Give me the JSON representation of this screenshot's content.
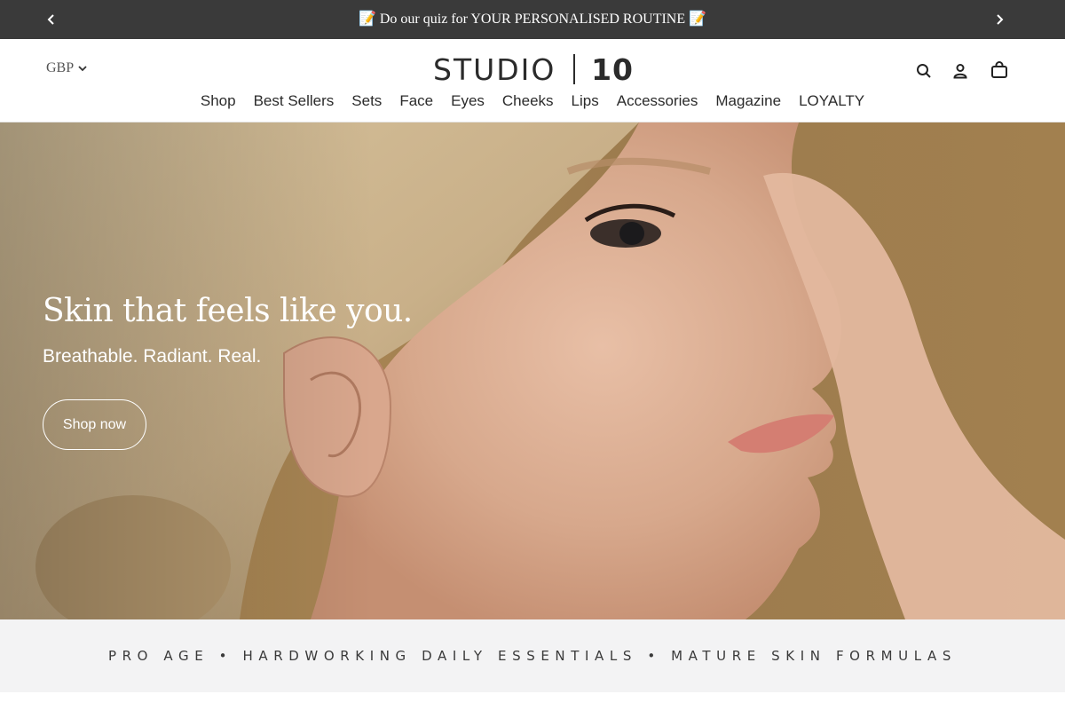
{
  "announcement": {
    "message": "📝 Do our quiz for YOUR PERSONALISED ROUTINE 📝",
    "prev_icon": "chevron-left-icon",
    "next_icon": "chevron-right-icon",
    "background": "#3a3a3a"
  },
  "header": {
    "currency": "GBP",
    "logo_word": "STUDIO",
    "logo_number": "10",
    "icons": [
      "search-icon",
      "account-icon",
      "bag-icon"
    ]
  },
  "nav": {
    "items": [
      "Shop",
      "Best Sellers",
      "Sets",
      "Face",
      "Eyes",
      "Cheeks",
      "Lips",
      "Accessories",
      "Magazine",
      "LOYALTY"
    ]
  },
  "hero": {
    "title": "Skin that feels like you.",
    "subtitle": "Breathable. Radiant. Real.",
    "cta_label": "Shop now",
    "background": "#a88553"
  },
  "tagline": {
    "text": "PRO AGE • HARDWORKING DAILY ESSENTIALS • MATURE SKIN FORMULAS"
  }
}
